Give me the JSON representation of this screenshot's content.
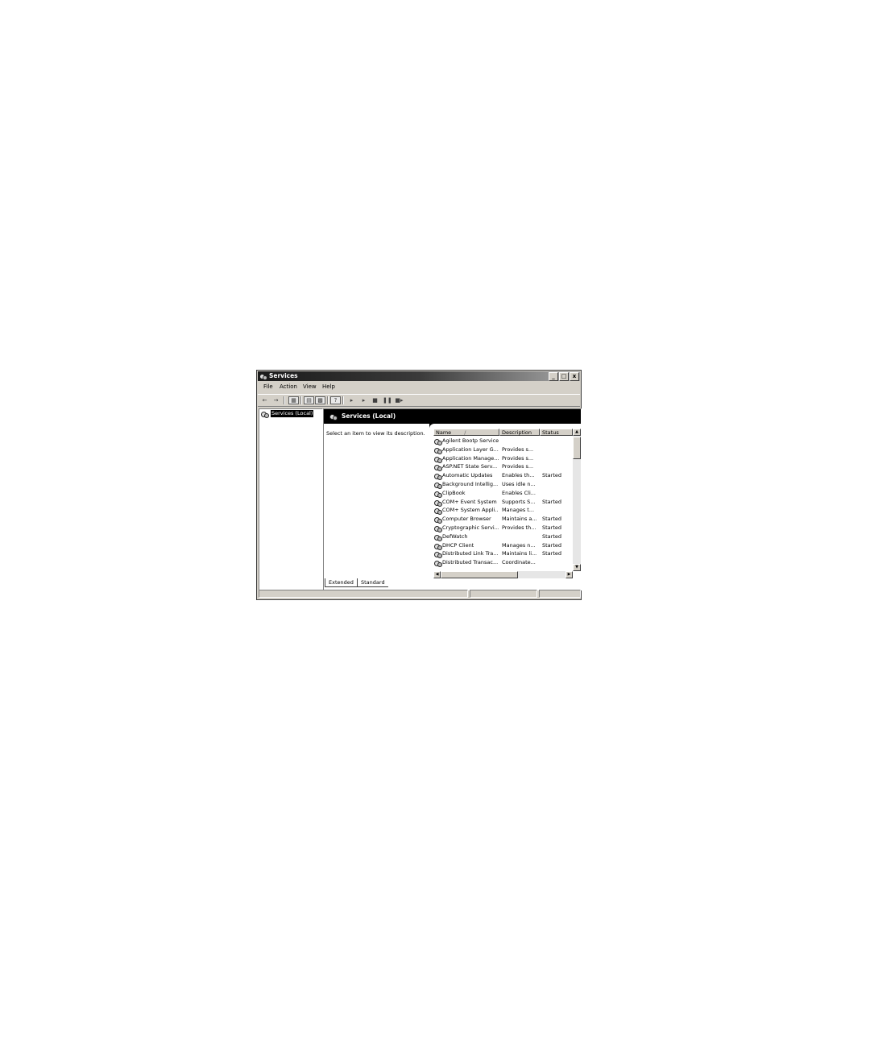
{
  "window": {
    "title": "Services",
    "minimize": "_",
    "maximize": "□",
    "close": "x"
  },
  "menu": [
    "File",
    "Action",
    "View",
    "Help"
  ],
  "tree": {
    "selected": "Services (Local)"
  },
  "panel": {
    "title": "Services (Local)",
    "description": "Select an item to view its description."
  },
  "columns": {
    "name": "Name",
    "description": "Description",
    "status": "Status"
  },
  "services": [
    {
      "name": "Agilent Bootp Service",
      "description": "",
      "status": ""
    },
    {
      "name": "Application Layer G...",
      "description": "Provides s...",
      "status": ""
    },
    {
      "name": "Application Manage...",
      "description": "Provides s...",
      "status": ""
    },
    {
      "name": "ASP.NET State Serv...",
      "description": "Provides s...",
      "status": ""
    },
    {
      "name": "Automatic Updates",
      "description": "Enables th...",
      "status": "Started"
    },
    {
      "name": "Background Intellig...",
      "description": "Uses idle n...",
      "status": ""
    },
    {
      "name": "ClipBook",
      "description": "Enables Cli...",
      "status": ""
    },
    {
      "name": "COM+ Event System",
      "description": "Supports S...",
      "status": "Started"
    },
    {
      "name": "COM+ System Appli...",
      "description": "Manages t...",
      "status": ""
    },
    {
      "name": "Computer Browser",
      "description": "Maintains a...",
      "status": "Started"
    },
    {
      "name": "Cryptographic Servi...",
      "description": "Provides th...",
      "status": "Started"
    },
    {
      "name": "DefWatch",
      "description": "",
      "status": "Started"
    },
    {
      "name": "DHCP Client",
      "description": "Manages n...",
      "status": "Started"
    },
    {
      "name": "Distributed Link Tra...",
      "description": "Maintains li...",
      "status": "Started"
    },
    {
      "name": "Distributed Transac...",
      "description": "Coordinate...",
      "status": ""
    }
  ],
  "tabs": [
    "Extended",
    "Standard"
  ],
  "colors": {
    "titlebar_start": "#1a1a1a",
    "titlebar_end": "#a8a8a8",
    "face": "#d4d0c8"
  }
}
